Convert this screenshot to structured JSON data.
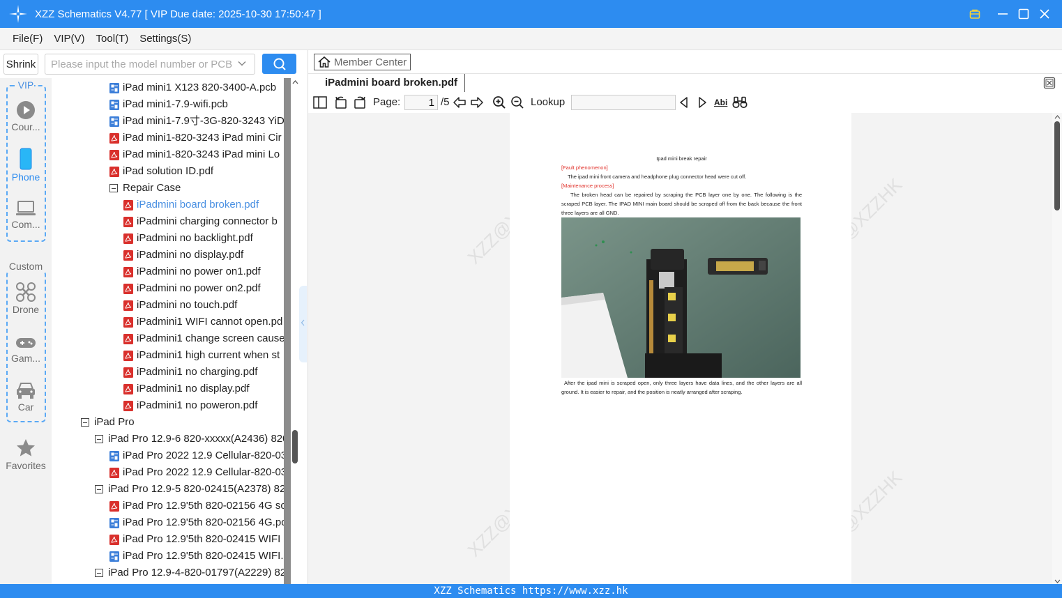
{
  "window": {
    "title": "XZZ Schematics V4.77 [ VIP Due date: 2025-10-30 17:50:47 ]"
  },
  "menu": [
    "File(F)",
    "VIP(V)",
    "Tool(T)",
    "Settings(S)"
  ],
  "search": {
    "shrink_label": "Shrink",
    "placeholder": "Please input the model number or PCB"
  },
  "leftnav": {
    "vip_label": "VIP",
    "custom_label": "Custom",
    "items": [
      {
        "label": "Cour...",
        "icon": "play-circle-icon"
      },
      {
        "label": "Phone",
        "icon": "phone-icon"
      },
      {
        "label": "Com...",
        "icon": "laptop-icon"
      },
      {
        "label": "Drone",
        "icon": "drone-icon"
      },
      {
        "label": "Gam...",
        "icon": "gamepad-icon"
      },
      {
        "label": "Car",
        "icon": "car-icon"
      },
      {
        "label": "Favorites",
        "icon": "star-icon"
      }
    ]
  },
  "tree": [
    {
      "label": "iPad mini1 X123 820-3400-A.pcb",
      "type": "pcb",
      "level": 2
    },
    {
      "label": "iPad mini1-7.9-wifi.pcb",
      "type": "pcb",
      "level": 2
    },
    {
      "label": "iPad mini1-7.9寸-3G-820-3243 YiD",
      "type": "pcb",
      "level": 2
    },
    {
      "label": "iPad mini1-820-3243 iPad mini Cir",
      "type": "pdf",
      "level": 2
    },
    {
      "label": "iPad mini1-820-3243 iPad mini Lo",
      "type": "pdf",
      "level": 2
    },
    {
      "label": "iPad solution ID.pdf",
      "type": "pdf",
      "level": 2
    },
    {
      "label": "Repair Case",
      "type": "folder",
      "level": 2
    },
    {
      "label": "iPadmini board broken.pdf",
      "type": "pdf",
      "level": 3,
      "selected": true
    },
    {
      "label": "iPadmini charging connector b",
      "type": "pdf",
      "level": 3
    },
    {
      "label": "iPadmini no backlight.pdf",
      "type": "pdf",
      "level": 3
    },
    {
      "label": "iPadmini no display.pdf",
      "type": "pdf",
      "level": 3
    },
    {
      "label": "iPadmini no power on1.pdf",
      "type": "pdf",
      "level": 3
    },
    {
      "label": "iPadmini no power on2.pdf",
      "type": "pdf",
      "level": 3
    },
    {
      "label": "iPadmini no touch.pdf",
      "type": "pdf",
      "level": 3
    },
    {
      "label": "iPadmini1 WIFI cannot open.pd",
      "type": "pdf",
      "level": 3
    },
    {
      "label": "iPadmini1 change screen cause",
      "type": "pdf",
      "level": 3
    },
    {
      "label": "iPadmini1 high current when st",
      "type": "pdf",
      "level": 3
    },
    {
      "label": "iPadmini1 no charging.pdf",
      "type": "pdf",
      "level": 3
    },
    {
      "label": "iPadmini1 no display.pdf",
      "type": "pdf",
      "level": 3
    },
    {
      "label": "iPadmini1 no poweron.pdf",
      "type": "pdf",
      "level": 3
    },
    {
      "label": "iPad Pro",
      "type": "folder",
      "level": 0
    },
    {
      "label": "iPad Pro 12.9-6 820-xxxxx(A2436) 820",
      "type": "folder",
      "level": 1
    },
    {
      "label": "iPad Pro 2022 12.9 Cellular-820-03",
      "type": "pcb",
      "level": 2
    },
    {
      "label": "iPad Pro 2022 12.9 Cellular-820-03",
      "type": "pdf",
      "level": 2
    },
    {
      "label": "iPad Pro 12.9-5 820-02415(A2378) 82",
      "type": "folder",
      "level": 1
    },
    {
      "label": "iPad Pro 12.9'5th 820-02156 4G sc",
      "type": "pdf",
      "level": 2
    },
    {
      "label": "iPad Pro 12.9'5th 820-02156 4G.pc",
      "type": "pcb",
      "level": 2
    },
    {
      "label": "iPad Pro 12.9'5th 820-02415 WIFI s",
      "type": "pdf",
      "level": 2
    },
    {
      "label": "iPad Pro 12.9'5th 820-02415 WIFI.p",
      "type": "pcb",
      "level": 2
    },
    {
      "label": "iPad Pro 12.9-4-820-01797(A2229) 82",
      "type": "folder",
      "level": 1
    }
  ],
  "viewer": {
    "member_center": "Member Center",
    "tab_title": "iPadmini board broken.pdf",
    "page_label": "Page:",
    "page_current": "1",
    "page_total": "/5",
    "lookup_label": "Lookup",
    "abi_label": "Abi",
    "watermark": "XZZ@XZZHK"
  },
  "document": {
    "heading": "Ipad mini break repair",
    "fault_label": "[Fault phenomenon]",
    "fault_text": "The ipad mini front camera and headphone plug connector head were cut off.",
    "maint_label": "[Maintenance process]",
    "maint_text": "The broken head can be repaired by scraping the PCB layer one by one. The following is the scraped PCB layer. The IPAD MINI main board should be scraped off from the back because the front three layers are all GND.",
    "caption": "After the ipad mini is scraped open, only three layers have data lines, and the other layers are all ground. It is easier to repair, and the position is neatly arranged after scraping."
  },
  "status": {
    "text": "XZZ Schematics https://www.xzz.hk"
  },
  "colors": {
    "accent": "#2d8cf0",
    "selected_text": "#4a90e2",
    "pdf_red": "#d9302c",
    "pcb_blue": "#3d7fd9",
    "doc_red": "#e0302a"
  }
}
